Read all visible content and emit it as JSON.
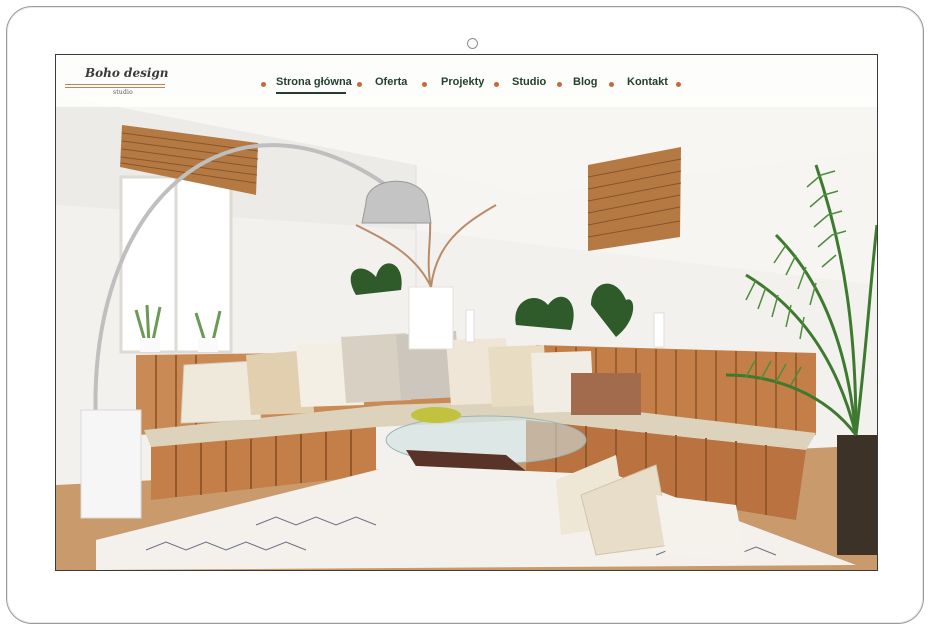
{
  "logo": {
    "title": "Boho design",
    "subtitle": "studio"
  },
  "nav": {
    "items": [
      {
        "label": "Strona główna",
        "active": true
      },
      {
        "label": "Oferta",
        "active": false
      },
      {
        "label": "Projekty",
        "active": false
      },
      {
        "label": "Studio",
        "active": false
      },
      {
        "label": "Blog",
        "active": false
      },
      {
        "label": "Kontakt",
        "active": false
      }
    ]
  },
  "colors": {
    "nav_text": "#24402c",
    "nav_dot": "#c46a3a",
    "logo_line": "#b8865a",
    "device_frame": "#9a9a9a"
  },
  "icons": [
    "camera-icon"
  ]
}
